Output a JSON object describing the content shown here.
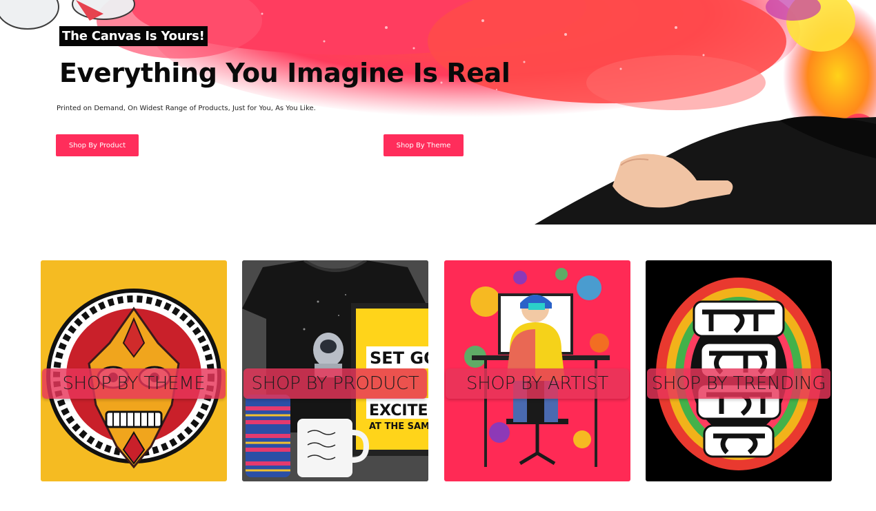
{
  "hero": {
    "tagline": "The Canvas Is Yours!",
    "headline": "Everything You Imagine Is Real",
    "subtext": "Printed on Demand, On Widest Range of Products, Just for You, As You Like.",
    "buttons": {
      "shop_by_product": "Shop By Product",
      "shop_by_theme": "Shop By Theme"
    }
  },
  "categories": [
    {
      "label": "SHOP BY THEME",
      "image": "mandala-mask-art"
    },
    {
      "label": "SHOP BY PRODUCT",
      "image": "tshirt-mug-poster-phonecase"
    },
    {
      "label": "SHOP BY ARTIST",
      "image": "artist-at-computer"
    },
    {
      "label": "SHOP BY TRENDING",
      "image": "bengali-typography-art"
    }
  ],
  "product_card": {
    "poster_line1": "SET GOA",
    "poster_line2": "EXCITE Y",
    "poster_line3": "AT THE SAME"
  },
  "colors": {
    "accent": "#ff2d5b",
    "theme_card_bg": "#f5bb22",
    "artist_card_bg": "#ff2a55",
    "trending_card_bg": "#000000"
  }
}
